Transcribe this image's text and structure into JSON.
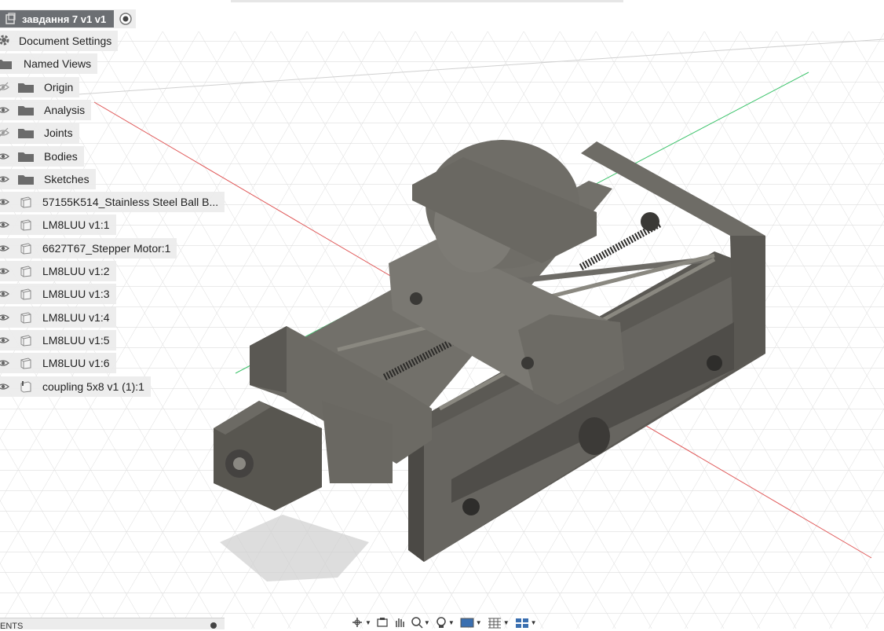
{
  "browser": {
    "root_title": "завдання 7 v1 v1",
    "items": [
      {
        "label": "Document Settings",
        "icon": "gear-icon",
        "eye": null
      },
      {
        "label": "Named Views",
        "icon": "folder-icon",
        "eye": null
      },
      {
        "label": "Origin",
        "icon": "folder-icon",
        "eye": "hidden"
      },
      {
        "label": "Analysis",
        "icon": "folder-icon",
        "eye": "visible"
      },
      {
        "label": "Joints",
        "icon": "folder-icon",
        "eye": "hidden"
      },
      {
        "label": "Bodies",
        "icon": "folder-icon",
        "eye": "visible"
      },
      {
        "label": "Sketches",
        "icon": "folder-icon",
        "eye": "visible"
      },
      {
        "label": "57155K514_Stainless Steel Ball B...",
        "icon": "component-icon",
        "eye": "visible"
      },
      {
        "label": "LM8LUU v1:1",
        "icon": "component-icon",
        "eye": "visible"
      },
      {
        "label": "6627T67_Stepper Motor:1",
        "icon": "component-icon",
        "eye": "visible"
      },
      {
        "label": "LM8LUU v1:2",
        "icon": "component-icon",
        "eye": "visible"
      },
      {
        "label": "LM8LUU v1:3",
        "icon": "component-icon",
        "eye": "visible"
      },
      {
        "label": "LM8LUU v1:4",
        "icon": "component-icon",
        "eye": "visible"
      },
      {
        "label": "LM8LUU v1:5",
        "icon": "component-icon",
        "eye": "visible"
      },
      {
        "label": "LM8LUU v1:6",
        "icon": "component-icon",
        "eye": "visible"
      },
      {
        "label": "coupling 5x8 v1 (1):1",
        "icon": "component-link-icon",
        "eye": "visible"
      }
    ]
  },
  "bottom_panel": {
    "label": "ENTS"
  },
  "nav_bar": {
    "tools": [
      "orbit-icon",
      "look-at-icon",
      "pan-icon",
      "zoom-window-icon",
      "fit-icon",
      "display-settings-icon",
      "grid-settings-icon",
      "viewports-icon"
    ]
  },
  "colors": {
    "model_face": "#676560",
    "model_dark": "#4c4a46",
    "model_light": "#7a7872",
    "grid": "#dcdcdc",
    "axis_red": "#e05a5a",
    "axis_green": "#3cc36b",
    "panel_bg": "#ececec",
    "root_bg": "#6c6f73"
  }
}
